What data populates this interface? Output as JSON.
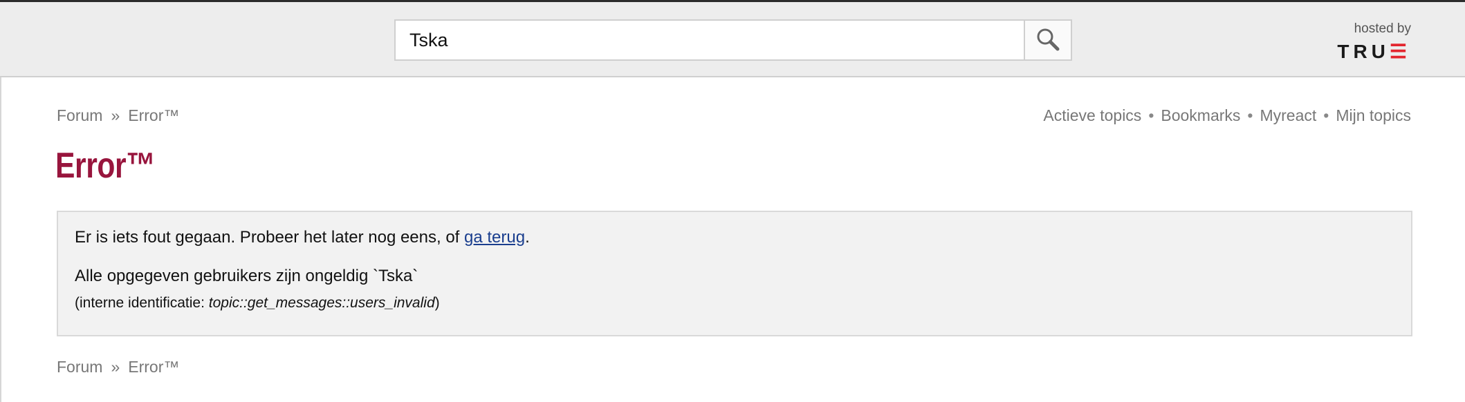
{
  "search": {
    "value": "Tska"
  },
  "hosted": {
    "label": "hosted by",
    "logo_text": "TRU",
    "logo_mark": "☰"
  },
  "breadcrumb": {
    "forum": "Forum",
    "separator": "»",
    "current": "Error™"
  },
  "top_links": [
    {
      "label": "Actieve topics"
    },
    {
      "label": "Bookmarks"
    },
    {
      "label": "Myreact"
    },
    {
      "label": "Mijn topics"
    }
  ],
  "link_separator": "•",
  "page_title": "Error™",
  "error": {
    "message_prefix": "Er is iets fout gegaan. Probeer het later nog eens, of ",
    "back_link": "ga terug",
    "message_suffix": ".",
    "detail": "Alle opgegeven gebruikers zijn ongeldig `Tska`",
    "id_prefix": "(interne identificatie: ",
    "id_value": "topic::get_messages::users_invalid",
    "id_suffix": ")"
  },
  "colors": {
    "title": "#98153d",
    "logo_accent": "#e3262e",
    "link": "#1a3e8e"
  }
}
